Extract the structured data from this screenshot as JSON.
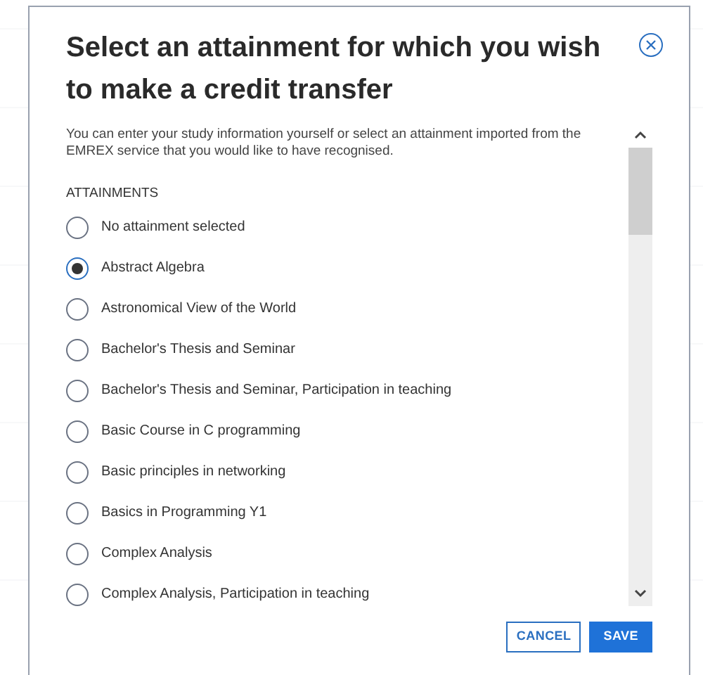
{
  "dialog": {
    "title": "Select an attainment for which you wish to make a credit transfer",
    "description": "You can enter your study information yourself or select an attainment imported from the EMREX service that you would like to have recognised.",
    "section_label": "ATTAINMENTS",
    "options": [
      {
        "label": "No attainment selected",
        "selected": false
      },
      {
        "label": "Abstract Algebra",
        "selected": true
      },
      {
        "label": "Astronomical View of the World",
        "selected": false
      },
      {
        "label": "Bachelor's Thesis and Seminar",
        "selected": false
      },
      {
        "label": "Bachelor's Thesis and Seminar, Participation in teaching",
        "selected": false
      },
      {
        "label": "Basic Course in C programming",
        "selected": false
      },
      {
        "label": "Basic principles in networking",
        "selected": false
      },
      {
        "label": "Basics in Programming Y1",
        "selected": false
      },
      {
        "label": "Complex Analysis",
        "selected": false
      },
      {
        "label": "Complex Analysis, Participation in teaching",
        "selected": false
      }
    ],
    "buttons": [
      {
        "label": "CANCEL",
        "kind": "secondary"
      },
      {
        "label": "SAVE",
        "kind": "primary"
      }
    ]
  }
}
